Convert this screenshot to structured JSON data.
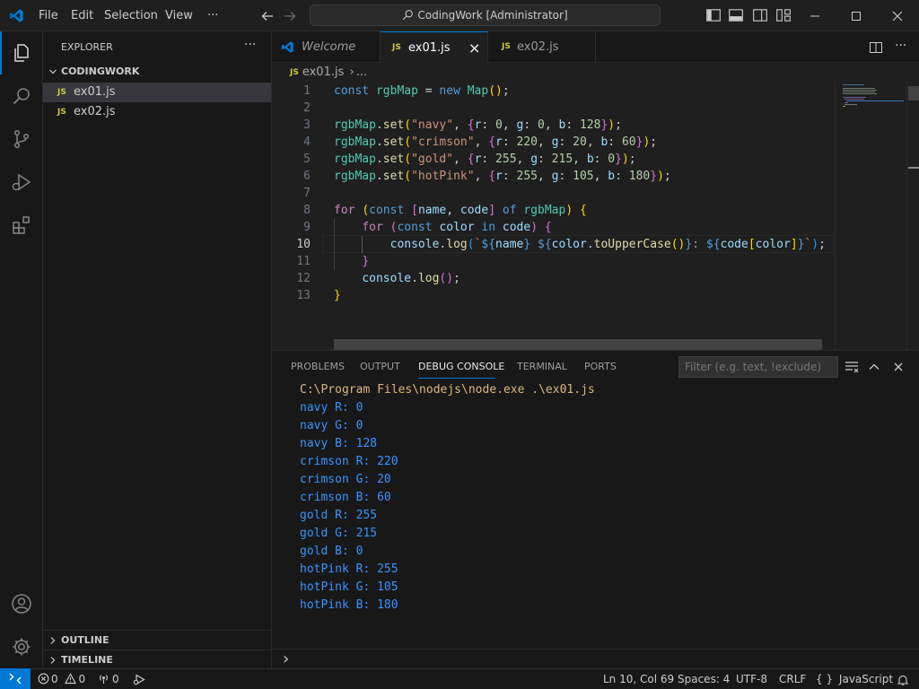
{
  "titlebar": {
    "menu": [
      "File",
      "Edit",
      "Selection",
      "View"
    ],
    "more": "···",
    "search_text": "CodingWork [Administrator]"
  },
  "sidebar": {
    "title": "EXPLORER",
    "more": "···",
    "folder": "CODINGWORK",
    "files": [
      {
        "badge": "JS",
        "name": "ex01.js"
      },
      {
        "badge": "JS",
        "name": "ex02.js"
      }
    ],
    "outline": "OUTLINE",
    "timeline": "TIMELINE"
  },
  "tabs": [
    {
      "label": "Welcome"
    },
    {
      "badge": "JS",
      "label": "ex01.js",
      "close": "×"
    },
    {
      "badge": "JS",
      "label": "ex02.js"
    }
  ],
  "breadcrumb": {
    "badge": "JS",
    "file": "ex01.js",
    "sep": "›",
    "rest": "..."
  },
  "editor": {
    "active_line": 10,
    "line_numbers": [
      "1",
      "2",
      "3",
      "4",
      "5",
      "6",
      "7",
      "8",
      "9",
      "10",
      "11",
      "12",
      "13"
    ]
  },
  "panel": {
    "tabs": [
      "PROBLEMS",
      "OUTPUT",
      "DEBUG CONSOLE",
      "TERMINAL",
      "PORTS"
    ],
    "active_tab": "DEBUG CONSOLE",
    "filter_placeholder": "Filter (e.g. text, !exclude)",
    "command": "C:\\Program Files\\nodejs\\node.exe .\\ex01.js",
    "output": [
      "navy R: 0",
      "navy G: 0",
      "navy B: 128",
      "crimson R: 220",
      "crimson G: 20",
      "crimson B: 60",
      "gold R: 255",
      "gold G: 215",
      "gold B: 0",
      "hotPink R: 255",
      "hotPink G: 105",
      "hotPink B: 180"
    ],
    "prompt": "›"
  },
  "statusbar": {
    "errors": "0",
    "warnings": "0",
    "ports": "0",
    "position": "Ln 10, Col 69",
    "spaces": "Spaces: 4",
    "encoding": "UTF-8",
    "eol": "CRLF",
    "lang_braces": "{ }",
    "language": "JavaScript"
  },
  "colors": {
    "accent": "#0078d4",
    "js_badge": "#cbcb41",
    "console_output": "#3794ff",
    "console_command": "#dcb67a"
  }
}
